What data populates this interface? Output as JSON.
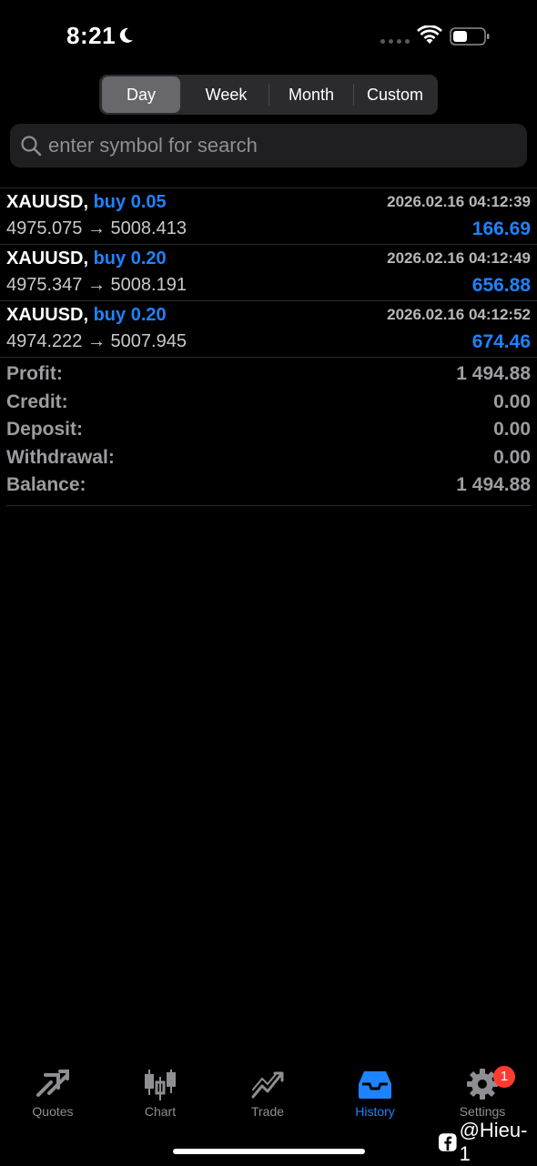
{
  "status_bar": {
    "time": "8:21"
  },
  "segments": [
    {
      "label": "Day",
      "active": true
    },
    {
      "label": "Week",
      "active": false
    },
    {
      "label": "Month",
      "active": false
    },
    {
      "label": "Custom",
      "active": false
    }
  ],
  "search": {
    "placeholder": "enter symbol for search",
    "value": ""
  },
  "trades": [
    {
      "symbol": "XAUUSD,",
      "side": "buy 0.05",
      "time": "2026.02.16 04:12:39",
      "open": "4975.075",
      "close": "5008.413",
      "profit": "166.69"
    },
    {
      "symbol": "XAUUSD,",
      "side": "buy 0.20",
      "time": "2026.02.16 04:12:49",
      "open": "4975.347",
      "close": "5008.191",
      "profit": "656.88"
    },
    {
      "symbol": "XAUUSD,",
      "side": "buy 0.20",
      "time": "2026.02.16 04:12:52",
      "open": "4974.222",
      "close": "5007.945",
      "profit": "674.46"
    }
  ],
  "arrow": "→",
  "summary": {
    "profit_label": "Profit:",
    "profit": "1 494.88",
    "credit_label": "Credit:",
    "credit": "0.00",
    "deposit_label": "Deposit:",
    "deposit": "0.00",
    "withdrawal_label": "Withdrawal:",
    "withdrawal": "0.00",
    "balance_label": "Balance:",
    "balance": "1 494.88"
  },
  "tabbar": {
    "items": [
      {
        "label": "Quotes",
        "icon": "quotes-icon",
        "active": false
      },
      {
        "label": "Chart",
        "icon": "chart-icon",
        "active": false
      },
      {
        "label": "Trade",
        "icon": "trade-icon",
        "active": false
      },
      {
        "label": "History",
        "icon": "history-icon",
        "active": true
      },
      {
        "label": "Settings",
        "icon": "gear-icon",
        "active": false
      }
    ],
    "settings_badge": "1"
  },
  "watermark": "@Hieu-1",
  "colors": {
    "accent": "#1e83ff",
    "background": "#000000",
    "badge": "#ff3b30"
  }
}
